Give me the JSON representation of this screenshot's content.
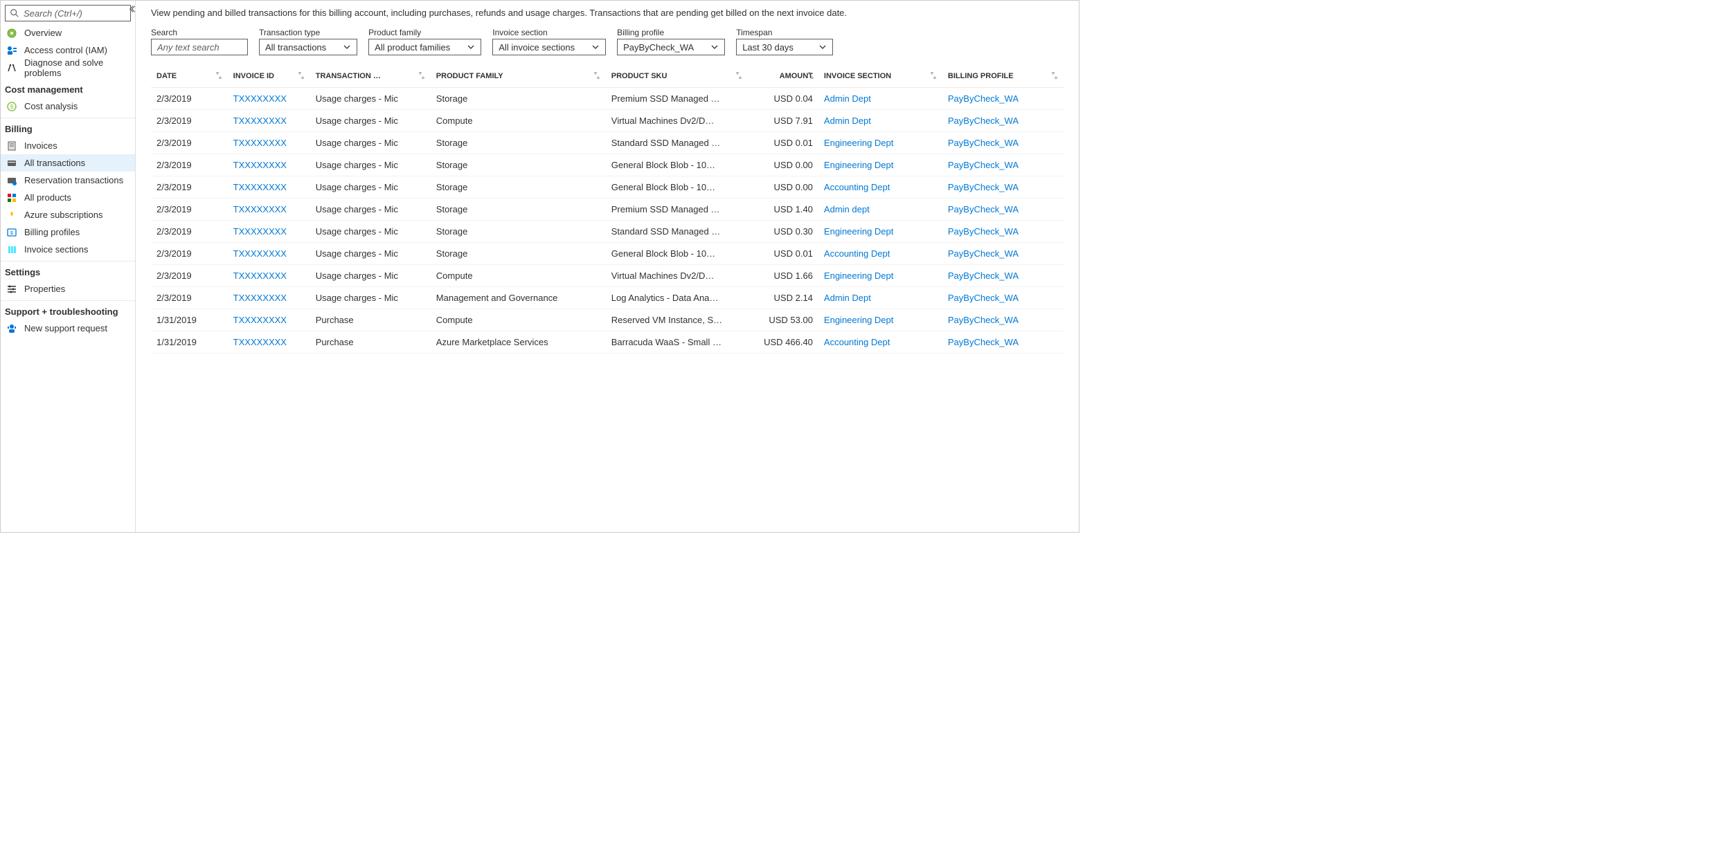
{
  "sidebar": {
    "search_placeholder": "Search (Ctrl+/)",
    "top": [
      {
        "icon": "overview",
        "label": "Overview"
      },
      {
        "icon": "access",
        "label": "Access control (IAM)"
      },
      {
        "icon": "diagnose",
        "label": "Diagnose and solve problems"
      }
    ],
    "sections": [
      {
        "title": "Cost management",
        "items": [
          {
            "icon": "cost",
            "label": "Cost analysis"
          }
        ]
      },
      {
        "title": "Billing",
        "items": [
          {
            "icon": "invoice",
            "label": "Invoices"
          },
          {
            "icon": "alltx",
            "label": "All transactions",
            "selected": true
          },
          {
            "icon": "restx",
            "label": "Reservation transactions"
          },
          {
            "icon": "products",
            "label": "All products"
          },
          {
            "icon": "subs",
            "label": "Azure subscriptions"
          },
          {
            "icon": "profiles",
            "label": "Billing profiles"
          },
          {
            "icon": "invsec",
            "label": "Invoice sections"
          }
        ]
      },
      {
        "title": "Settings",
        "items": [
          {
            "icon": "props",
            "label": "Properties"
          }
        ]
      },
      {
        "title": "Support + troubleshooting",
        "items": [
          {
            "icon": "support",
            "label": "New support request"
          }
        ]
      }
    ]
  },
  "main": {
    "description": "View pending and billed transactions for this billing account, including purchases, refunds and usage charges. Transactions that are pending get billed on the next invoice date.",
    "filters": {
      "search": {
        "label": "Search",
        "placeholder": "Any text search"
      },
      "txtype": {
        "label": "Transaction type",
        "value": "All transactions"
      },
      "pfamily": {
        "label": "Product family",
        "value": "All product families"
      },
      "insec": {
        "label": "Invoice section",
        "value": "All invoice sections"
      },
      "bprof": {
        "label": "Billing profile",
        "value": "PayByCheck_WA"
      },
      "timespan": {
        "label": "Timespan",
        "value": "Last 30 days"
      }
    },
    "columns": [
      "DATE",
      "INVOICE ID",
      "TRANSACTION …",
      "PRODUCT FAMILY",
      "PRODUCT SKU",
      "AMOUNT",
      "INVOICE SECTION",
      "BILLING PROFILE"
    ],
    "rows": [
      {
        "date": "2/3/2019",
        "inv": "TXXXXXXXX",
        "tx": "Usage charges - Mic",
        "pf": "Storage",
        "sku": "Premium SSD Managed …",
        "amt": "USD 0.04",
        "sec": "Admin Dept",
        "bp": "PayByCheck_WA"
      },
      {
        "date": "2/3/2019",
        "inv": "TXXXXXXXX",
        "tx": "Usage charges - Mic",
        "pf": "Compute",
        "sku": "Virtual Machines Dv2/D…",
        "amt": "USD 7.91",
        "sec": "Admin Dept",
        "bp": "PayByCheck_WA"
      },
      {
        "date": "2/3/2019",
        "inv": "TXXXXXXXX",
        "tx": "Usage charges - Mic",
        "pf": "Storage",
        "sku": "Standard SSD Managed …",
        "amt": "USD 0.01",
        "sec": "Engineering Dept",
        "bp": "PayByCheck_WA"
      },
      {
        "date": "2/3/2019",
        "inv": "TXXXXXXXX",
        "tx": "Usage charges - Mic",
        "pf": "Storage",
        "sku": "General Block Blob - 10…",
        "amt": "USD 0.00",
        "sec": "Engineering Dept",
        "bp": "PayByCheck_WA"
      },
      {
        "date": "2/3/2019",
        "inv": "TXXXXXXXX",
        "tx": "Usage charges - Mic",
        "pf": "Storage",
        "sku": "General Block Blob - 10…",
        "amt": "USD 0.00",
        "sec": "Accounting Dept",
        "bp": "PayByCheck_WA"
      },
      {
        "date": "2/3/2019",
        "inv": "TXXXXXXXX",
        "tx": "Usage charges - Mic",
        "pf": "Storage",
        "sku": "Premium SSD Managed …",
        "amt": "USD 1.40",
        "sec": "Admin dept",
        "bp": "PayByCheck_WA"
      },
      {
        "date": "2/3/2019",
        "inv": "TXXXXXXXX",
        "tx": "Usage charges - Mic",
        "pf": "Storage",
        "sku": "Standard SSD Managed …",
        "amt": "USD 0.30",
        "sec": "Engineering Dept",
        "bp": "PayByCheck_WA"
      },
      {
        "date": "2/3/2019",
        "inv": "TXXXXXXXX",
        "tx": "Usage charges - Mic",
        "pf": "Storage",
        "sku": "General Block Blob - 10…",
        "amt": "USD 0.01",
        "sec": "Accounting Dept",
        "bp": "PayByCheck_WA"
      },
      {
        "date": "2/3/2019",
        "inv": "TXXXXXXXX",
        "tx": "Usage charges - Mic",
        "pf": "Compute",
        "sku": "Virtual Machines Dv2/D…",
        "amt": "USD 1.66",
        "sec": "Engineering Dept",
        "bp": "PayByCheck_WA"
      },
      {
        "date": "2/3/2019",
        "inv": "TXXXXXXXX",
        "tx": "Usage charges - Mic",
        "pf": "Management and Governance",
        "sku": "Log Analytics - Data Ana…",
        "amt": "USD 2.14",
        "sec": "Admin Dept",
        "bp": "PayByCheck_WA"
      },
      {
        "date": "1/31/2019",
        "inv": "TXXXXXXXX",
        "tx": "Purchase",
        "pf": "Compute",
        "sku": "Reserved VM Instance, S…",
        "amt": "USD 53.00",
        "sec": "Engineering Dept",
        "bp": "PayByCheck_WA"
      },
      {
        "date": "1/31/2019",
        "inv": "TXXXXXXXX",
        "tx": "Purchase",
        "pf": "Azure Marketplace Services",
        "sku": "Barracuda WaaS - Small …",
        "amt": "USD 466.40",
        "sec": "Accounting Dept",
        "bp": "PayByCheck_WA"
      }
    ]
  }
}
